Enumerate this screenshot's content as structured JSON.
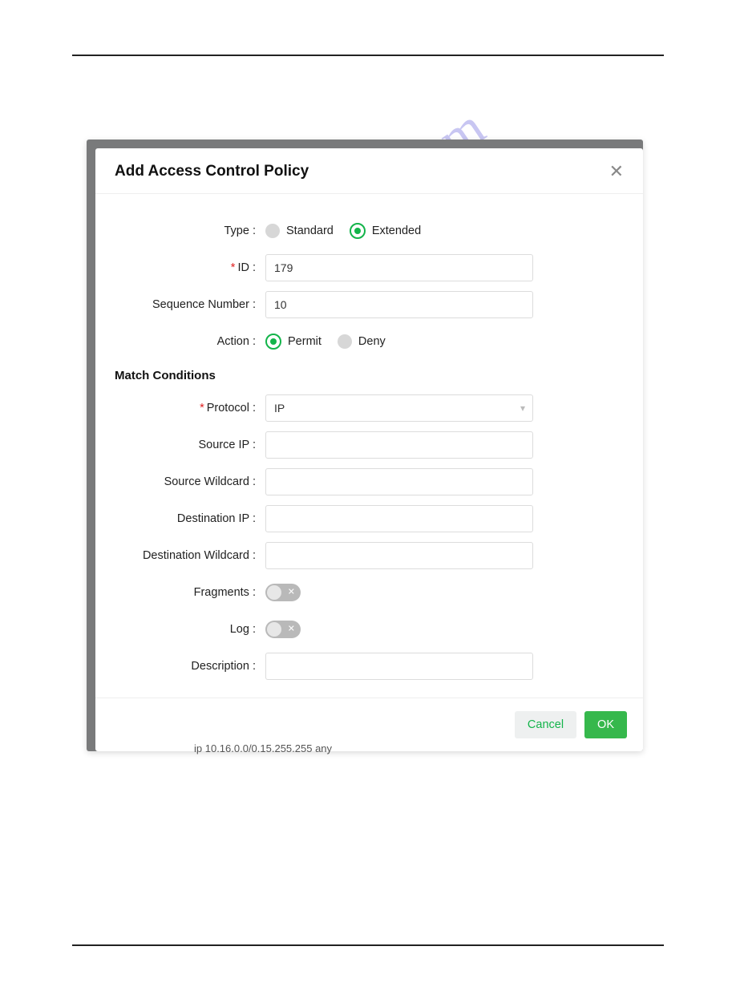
{
  "dialog": {
    "title": "Add Access Control Policy",
    "labels": {
      "type": "Type",
      "id": "ID",
      "sequence_number": "Sequence Number",
      "action": "Action",
      "match_conditions": "Match Conditions",
      "protocol": "Protocol",
      "source_ip": "Source IP",
      "source_wildcard": "Source Wildcard",
      "destination_ip": "Destination IP",
      "destination_wildcard": "Destination Wildcard",
      "fragments": "Fragments",
      "log": "Log",
      "description": "Description"
    },
    "type_options": {
      "standard": "Standard",
      "extended": "Extended"
    },
    "type_selected": "extended",
    "id_value": "179",
    "sequence_value": "10",
    "action_options": {
      "permit": "Permit",
      "deny": "Deny"
    },
    "action_selected": "permit",
    "protocol_value": "IP",
    "source_ip_value": "",
    "source_wildcard_value": "",
    "destination_ip_value": "",
    "destination_wildcard_value": "",
    "fragments_on": false,
    "log_on": false,
    "description_value": "",
    "buttons": {
      "cancel": "Cancel",
      "ok": "OK"
    }
  },
  "watermark": "manualshive.com",
  "background_row": "ip       10.16.0.0/0.15.255.255    any"
}
